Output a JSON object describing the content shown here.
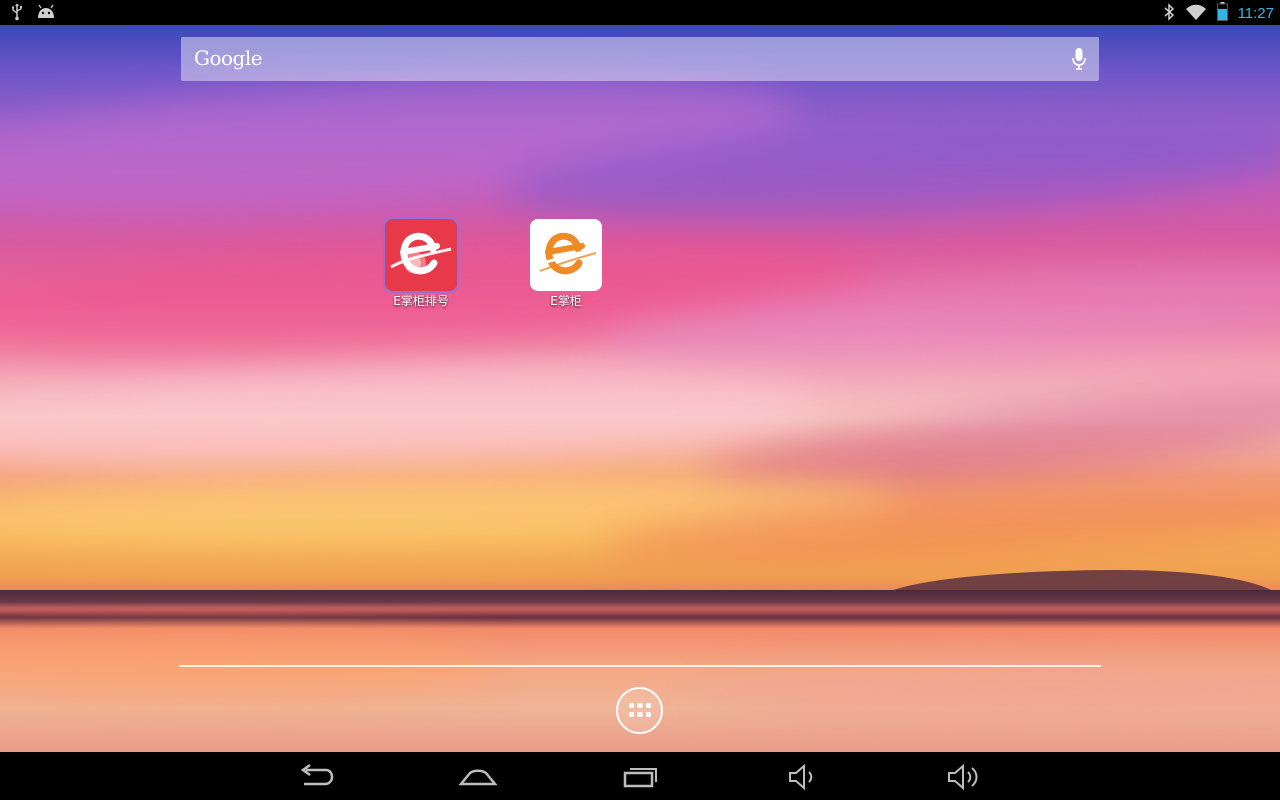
{
  "status_bar": {
    "left_icons": [
      "usb-icon",
      "android-debug-icon"
    ],
    "right_icons": [
      "bluetooth-icon",
      "wifi-icon",
      "battery-icon"
    ],
    "time": "11:27"
  },
  "search": {
    "logo_text": "Google",
    "mic_icon": "mic-icon"
  },
  "home": {
    "apps": [
      {
        "label": "E掌柜排号",
        "icon": "e-queue-app-icon",
        "accent": "#e8394a"
      },
      {
        "label": "E掌柜",
        "icon": "e-store-app-icon",
        "accent": "#f08a24"
      }
    ]
  },
  "dock": {
    "all_apps_icon": "all-apps-icon"
  },
  "nav_bar": {
    "buttons": [
      "back-icon",
      "home-icon",
      "recent-apps-icon",
      "volume-down-icon",
      "volume-up-icon"
    ]
  },
  "colors": {
    "clock": "#33b5e5",
    "status_icons": "#cfcfcf"
  }
}
